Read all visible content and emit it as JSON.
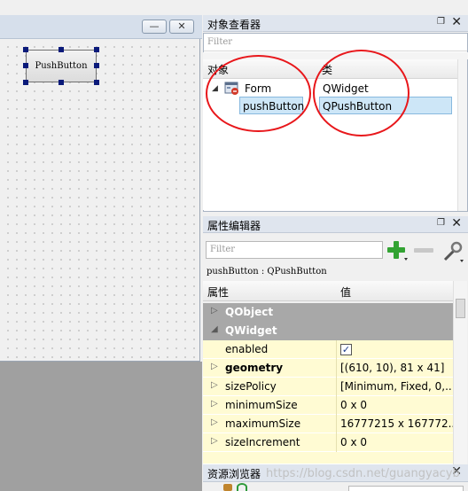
{
  "form": {
    "button_label": "PushButton",
    "minimize_glyph": "—",
    "close_glyph": "✕"
  },
  "object_inspector": {
    "title": "对象查看器",
    "filter_placeholder": "Filter",
    "col_object": "对象",
    "col_class": "类",
    "rows": [
      {
        "object": "Form",
        "class": "QWidget"
      },
      {
        "object": "pushButton",
        "class": "QPushButton"
      }
    ]
  },
  "property_editor": {
    "title": "属性编辑器",
    "filter_placeholder": "Filter",
    "subtitle": "pushButton : QPushButton",
    "col_property": "属性",
    "col_value": "值",
    "groups": [
      "QObject",
      "QWidget"
    ],
    "properties": [
      {
        "name": "enabled",
        "value": ""
      },
      {
        "name": "geometry",
        "value": "[(610, 10), 81 x 41]"
      },
      {
        "name": "sizePolicy",
        "value": "[Minimum, Fixed, 0,..."
      },
      {
        "name": "minimumSize",
        "value": "0 x 0"
      },
      {
        "name": "maximumSize",
        "value": "16777215 x 167772..."
      },
      {
        "name": "sizeIncrement",
        "value": "0 x 0"
      }
    ],
    "enabled_checked": "✓"
  },
  "resource_browser": {
    "title": "资源浏览器"
  },
  "dock_controls": {
    "float_glyph": "❐",
    "close_glyph": "✕"
  },
  "watermark": "https://blog.csdn.net/guangyacyb"
}
